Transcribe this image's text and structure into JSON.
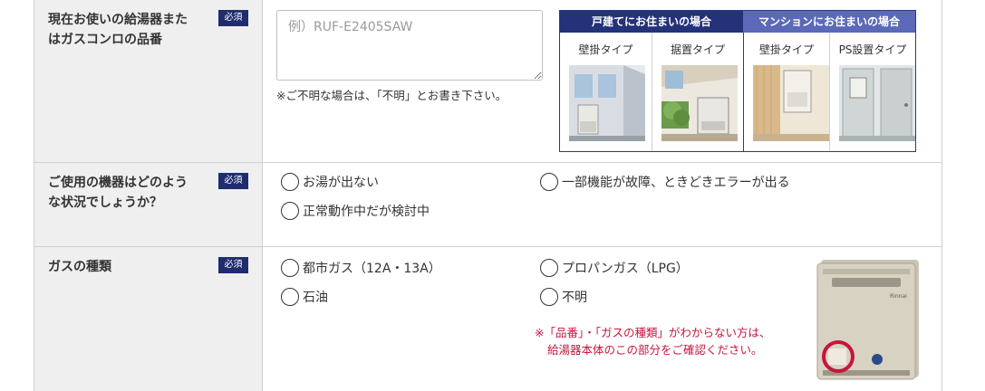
{
  "required_label": "必須",
  "rows": {
    "model": {
      "label": "現在お使いの給湯器またはガスコンロの品番",
      "placeholder": "例）RUF-E2405SAW",
      "value": "",
      "note": "※ご不明な場合は、「不明」とお書き下さい。"
    },
    "situation": {
      "label": "ご使用の機器はどのような状況でしょうか？",
      "options": [
        "お湯が出ない",
        "一部機能が故障、ときどきエラーが出る",
        "正常動作中だが検討中"
      ]
    },
    "gas": {
      "label": "ガスの種類",
      "options": [
        "都市ガス（12A・13A）",
        "プロパンガス（LPG）",
        "石油",
        "不明"
      ],
      "warning_lines": [
        "※「品番」・「ガスの種類」がわからない方は、",
        "給湯器本体のこの部分をご確認ください。"
      ]
    }
  },
  "install_types": {
    "house_header": "戸建てにお住まいの場合",
    "mansion_header": "マンションにお住まいの場合",
    "types": [
      "壁掛タイプ",
      "据置タイプ",
      "壁掛タイプ",
      "PS設置タイプ"
    ]
  },
  "colors": {
    "required_badge": "#1f2d6e",
    "house_header": "#24327a",
    "mansion_header": "#5b69b8",
    "warning_text": "#c8143c",
    "label_bg": "#efefef"
  }
}
